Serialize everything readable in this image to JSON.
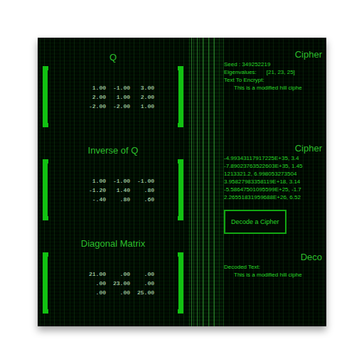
{
  "matrices": [
    {
      "title": "Q",
      "rows": [
        [
          "1.00",
          "-1.00",
          "3.00"
        ],
        [
          "2.00",
          "1.00",
          "2.00"
        ],
        [
          "-2.00",
          "-2.00",
          "1.00"
        ]
      ]
    },
    {
      "title": "Inverse of Q",
      "rows": [
        [
          "1.00",
          "-1.00",
          "-1.00"
        ],
        [
          "-1.20",
          "1.40",
          ".80"
        ],
        [
          "-.40",
          ".80",
          ".60"
        ]
      ]
    },
    {
      "title": "Diagonal Matrix",
      "rows": [
        [
          "21.00",
          ".00",
          ".00"
        ],
        [
          ".00",
          "23.00",
          ".00"
        ],
        [
          ".00",
          ".00",
          "25.00"
        ]
      ]
    }
  ],
  "cipher_input": {
    "title": "Cipher",
    "seed": "Seed : 349252219",
    "eigen_label": "Eigenvalues:",
    "eigenvalues": "[21, 23, 25]",
    "text_label": "Text To Encrypt:",
    "text": "This is a modified hill ciphe"
  },
  "cipher_output": {
    "title": "Cipher",
    "lines": [
      "-4.99343117917225E+35, 3.4",
      "-7.89023763522603E+35, 1.45",
      "1213321.2, 6.998053273504",
      "3.95827983358119E+18, 3.14",
      "-5.58647501095599E+25, -1.7",
      "2.26551831959688E+26, 6.52"
    ]
  },
  "decode_button": {
    "label": "Decode a Cipher"
  },
  "decoded": {
    "title": "Deco",
    "label": "Decoded Text:",
    "text": "This is a modified hill ciphe"
  }
}
